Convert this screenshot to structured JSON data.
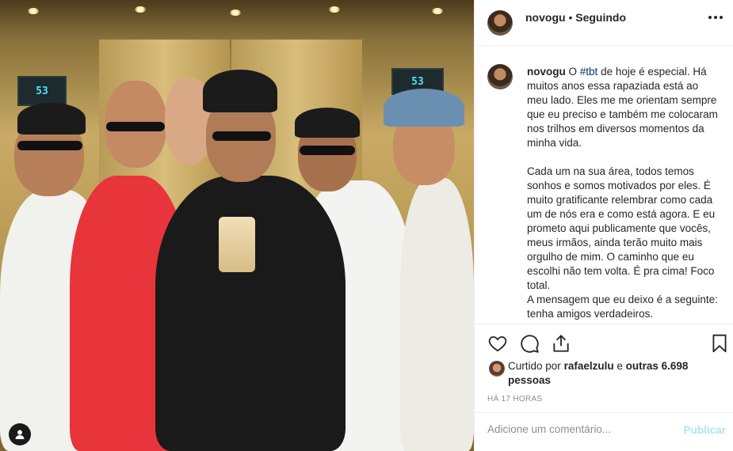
{
  "post": {
    "username": "novogu",
    "separator": "•",
    "follow_status": "Seguindo",
    "caption": {
      "username": "novogu",
      "pre_tag": "O ",
      "hashtag": "#tbt",
      "paragraph1_rest": " de hoje é especial. Há muitos anos essa rapaziada está ao meu lado. Eles me me orientam sempre que eu preciso e também me colocaram nos trilhos em diversos momentos da minha vida.",
      "paragraph2": "Cada um na sua área, todos temos sonhos e somos motivados por eles. É muito gratificante relembrar como cada um de nós era e como está agora. E eu prometo aqui publicamente que vocês, meus irmãos, ainda terão muito mais orgulho de mim. O caminho que eu escolhi não tem volta. É pra cima! Foco total.",
      "paragraph3": "A mensagem que eu deixo é a seguinte: tenha amigos verdadeiros."
    },
    "likes": {
      "prefix": "Curtido por",
      "liker": "rafaelzulu",
      "conjunction": "e",
      "others": "outras 6.698 pessoas"
    },
    "timestamp": "HÁ 17 HORAS",
    "comment": {
      "placeholder": "Adicione um comentário...",
      "publish_label": "Publicar"
    }
  },
  "photo": {
    "elevator_display_left": "53",
    "elevator_display_right": "53"
  },
  "icons": {
    "like": "heart-icon",
    "comment": "comment-icon",
    "share": "share-icon",
    "save": "bookmark-icon",
    "more": "more-options-icon",
    "tagged": "user-tag-icon"
  },
  "colors": {
    "text": "#262626",
    "muted": "#8e8e8e",
    "link": "#003569",
    "publish_disabled": "#b2dffc",
    "border": "#efefef"
  }
}
